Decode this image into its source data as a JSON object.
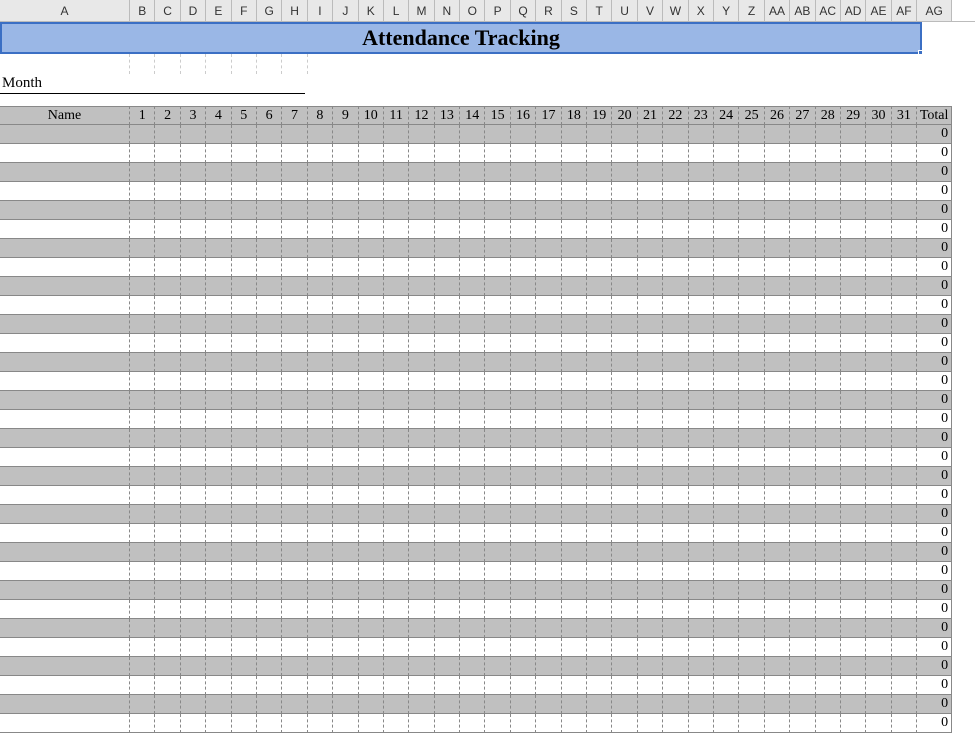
{
  "column_headers": [
    "A",
    "B",
    "C",
    "D",
    "E",
    "F",
    "G",
    "H",
    "I",
    "J",
    "K",
    "L",
    "M",
    "N",
    "O",
    "P",
    "Q",
    "R",
    "S",
    "T",
    "U",
    "V",
    "W",
    "X",
    "Y",
    "Z",
    "AA",
    "AB",
    "AC",
    "AD",
    "AE",
    "AF",
    "AG"
  ],
  "title": "Attendance Tracking",
  "month_label": "Month",
  "table": {
    "name_header": "Name",
    "day_headers": [
      "1",
      "2",
      "3",
      "4",
      "5",
      "6",
      "7",
      "8",
      "9",
      "10",
      "11",
      "12",
      "13",
      "14",
      "15",
      "16",
      "17",
      "18",
      "19",
      "20",
      "21",
      "22",
      "23",
      "24",
      "25",
      "26",
      "27",
      "28",
      "29",
      "30",
      "31"
    ],
    "total_header": "Total",
    "row_count": 32,
    "total_value": "0"
  }
}
